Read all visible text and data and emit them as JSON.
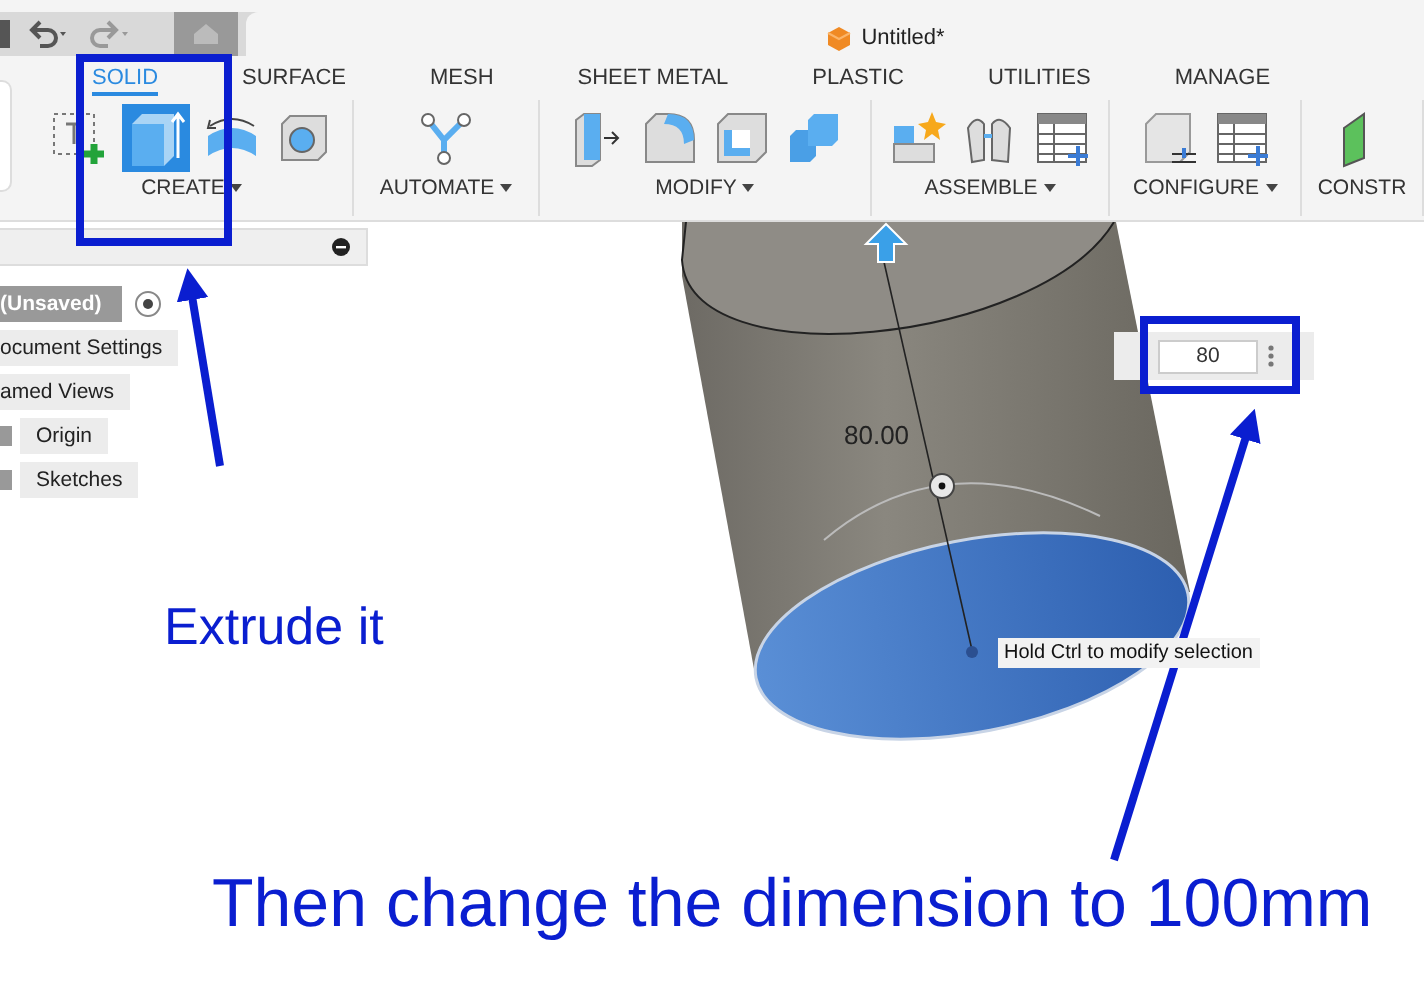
{
  "title": "Untitled*",
  "tabs": [
    {
      "label": "SOLID",
      "selected": true
    },
    {
      "label": "SURFACE",
      "selected": false
    },
    {
      "label": "MESH",
      "selected": false
    },
    {
      "label": "SHEET METAL",
      "selected": false
    },
    {
      "label": "PLASTIC",
      "selected": false
    },
    {
      "label": "UTILITIES",
      "selected": false
    },
    {
      "label": "MANAGE",
      "selected": false
    }
  ],
  "groups": [
    {
      "label": "CREATE",
      "kind": "create"
    },
    {
      "label": "AUTOMATE",
      "kind": "automate"
    },
    {
      "label": "MODIFY",
      "kind": "modify"
    },
    {
      "label": "ASSEMBLE",
      "kind": "assemble"
    },
    {
      "label": "CONFIGURE",
      "kind": "configure"
    },
    {
      "label": "CONSTR",
      "kind": "construct"
    }
  ],
  "browser": {
    "items": [
      {
        "label": "(Unsaved)",
        "kind": "root"
      },
      {
        "label": "ocument Settings",
        "kind": "folder"
      },
      {
        "label": "amed Views",
        "kind": "folder"
      },
      {
        "label": "Origin",
        "kind": "child"
      },
      {
        "label": "Sketches",
        "kind": "child"
      }
    ]
  },
  "viewport": {
    "dimension_label": "80.00",
    "input": {
      "value": "80"
    },
    "tooltip": "Hold Ctrl to modify selection"
  },
  "annotations": [
    {
      "text": "Extrude it",
      "kind": "small"
    },
    {
      "text": "Then change the dimension to 100mm",
      "kind": "large"
    }
  ]
}
